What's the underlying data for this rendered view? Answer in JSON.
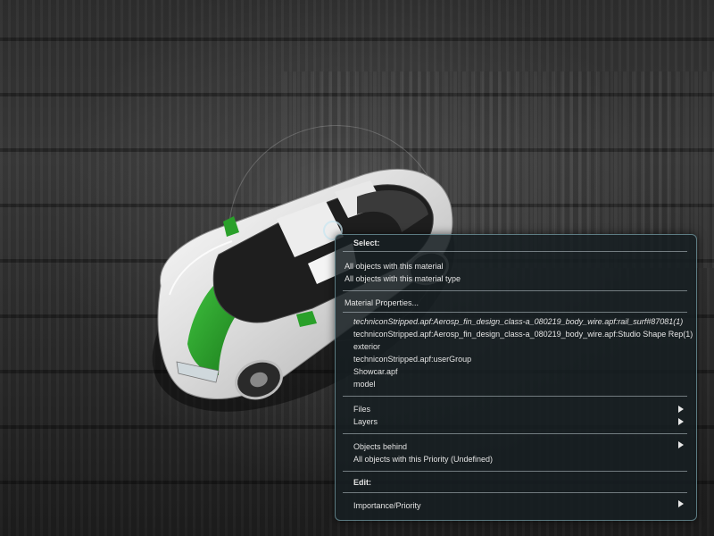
{
  "menu": {
    "select_title": "Select:",
    "all_with_material": "All objects with this material",
    "all_with_material_type": "All objects with this material type",
    "material_properties": "Material Properties...",
    "hierarchy": [
      "techniconStripped.apf:Aerosp_fin_design_class-a_080219_body_wire.apf:rail_surf#87081(1)",
      "techniconStripped.apf:Aerosp_fin_design_class-a_080219_body_wire.apf:Studio Shape Rep(1)",
      "exterior",
      "techniconStripped.apf:userGroup",
      "Showcar.apf",
      "model"
    ],
    "files": "Files",
    "layers": "Layers",
    "objects_behind": "Objects behind",
    "all_with_priority": "All objects with this Priority (Undefined)",
    "edit_title": "Edit:",
    "importance_priority": "Importance/Priority"
  },
  "icons": {
    "submenu": "chevron-right-icon"
  },
  "colors": {
    "menu_border": "#96c8d2",
    "menu_bg": "#161e22",
    "car_body": "#e6e6e6",
    "car_accent": "#2aa02a"
  }
}
